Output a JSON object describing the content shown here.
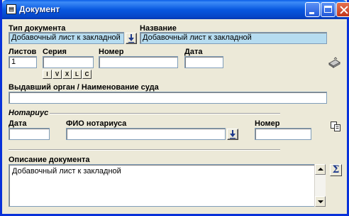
{
  "window": {
    "title": "Документ"
  },
  "doc_type": {
    "label": "Тип документа",
    "value": "Добавочный лист к закладной"
  },
  "name": {
    "label": "Название",
    "value": "Добавочный лист к закладной"
  },
  "sheets": {
    "label": "Листов",
    "value": "1"
  },
  "series": {
    "label": "Серия",
    "value": ""
  },
  "number": {
    "label": "Номер",
    "value": ""
  },
  "date": {
    "label": "Дата",
    "value": ""
  },
  "roman_buttons": [
    "I",
    "V",
    "X",
    "L",
    "C"
  ],
  "issuer": {
    "label": "Выдавший орган / Наименование суда",
    "value": ""
  },
  "notary": {
    "section_label": "Нотариус",
    "date_label": "Дата",
    "date_value": "",
    "name_label": "ФИО нотариуса",
    "name_value": "",
    "number_label": "Номер",
    "number_value": ""
  },
  "description": {
    "label": "Описание документа",
    "value": "Добавочный лист к закладной"
  },
  "icons": [
    "app-icon",
    "minimize-icon",
    "maximize-icon",
    "close-icon",
    "dropdown-arrow-icon",
    "stamp-icon",
    "copy-icon",
    "sum-icon"
  ],
  "colors": {
    "titlebar": "#0858e0",
    "highlight_field": "#b6dcf0",
    "window_bg": "#ece9d8"
  }
}
